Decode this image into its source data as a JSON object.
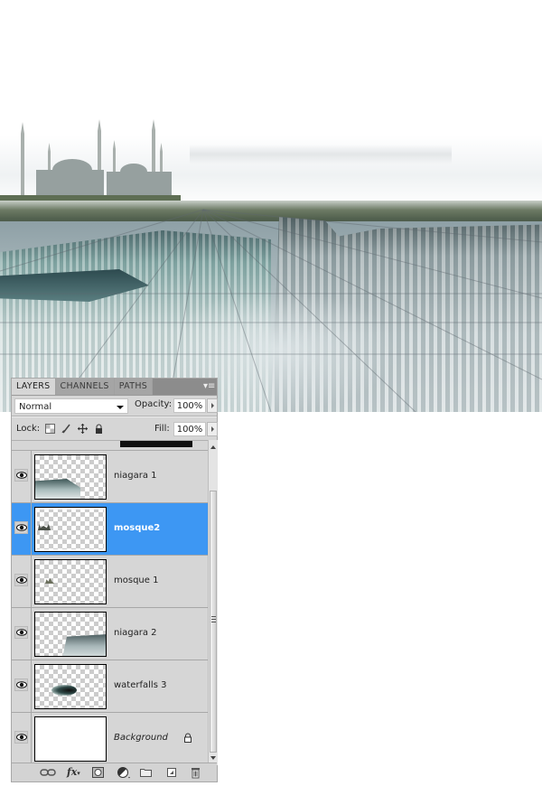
{
  "canvas": {
    "description": "Composite image: mosque with minarets on the left horizon above Niagara-style waterfalls, with perspective guide lines",
    "icons": [
      "mosque-image",
      "waterfall-image"
    ]
  },
  "panel": {
    "tabs": [
      {
        "label": "LAYERS",
        "active": true
      },
      {
        "label": "CHANNELS",
        "active": false
      },
      {
        "label": "PATHS",
        "active": false
      }
    ],
    "menu_icon": "panel-menu-icon",
    "blend_mode": "Normal",
    "opacity_label": "Opacity:",
    "opacity_value": "100%",
    "lock_label": "Lock:",
    "lock_icons": [
      "lock-transparent-pixels-icon",
      "lock-image-pixels-icon",
      "lock-position-icon",
      "lock-all-icon"
    ],
    "fill_label": "Fill:",
    "fill_value": "100%",
    "layers": [
      {
        "name": "niagara 1",
        "visible": true,
        "selected": false,
        "thumb": "niagara-1-thumbnail"
      },
      {
        "name": "mosque2",
        "visible": true,
        "selected": true,
        "thumb": "mosque2-thumbnail"
      },
      {
        "name": "mosque 1",
        "visible": true,
        "selected": false,
        "thumb": "mosque-1-thumbnail"
      },
      {
        "name": "niagara 2",
        "visible": true,
        "selected": false,
        "thumb": "niagara-2-thumbnail"
      },
      {
        "name": "waterfalls 3",
        "visible": true,
        "selected": false,
        "thumb": "waterfalls-3-thumbnail"
      },
      {
        "name": "Background",
        "visible": true,
        "selected": false,
        "locked": true,
        "thumb": "background-thumbnail"
      }
    ],
    "bottom_icons": [
      "link-layers-icon",
      "fx-icon",
      "layer-mask-icon",
      "adjustment-layer-icon",
      "new-group-icon",
      "new-layer-icon",
      "delete-layer-icon"
    ],
    "fx_label": "fx"
  },
  "colors": {
    "selection": "#3d97f3",
    "panel_bg": "#d6d6d6",
    "tabbar_bg": "#8c8c8c"
  }
}
